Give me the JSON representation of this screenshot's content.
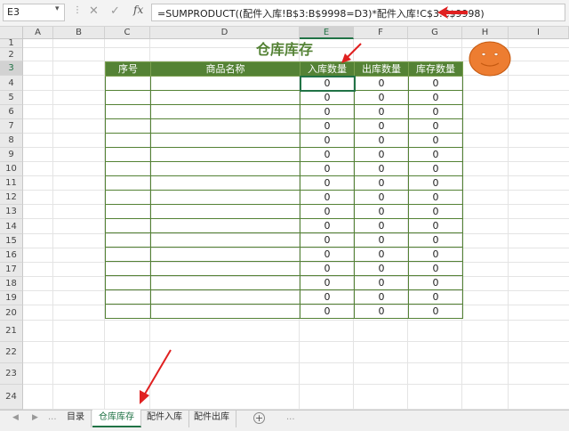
{
  "formula_bar": {
    "name_box": "E3",
    "formula": "=SUMPRODUCT((配件入库!B$3:B$9998=D3)*配件入库!C$3:C$9998)",
    "fx_label": "fx",
    "cancel_glyph": "✕",
    "enter_glyph": "✓"
  },
  "columns": [
    "A",
    "B",
    "C",
    "D",
    "E",
    "F",
    "G",
    "H",
    "I"
  ],
  "rows": [
    "1",
    "2",
    "3",
    "4",
    "5",
    "6",
    "7",
    "8",
    "9",
    "10",
    "11",
    "12",
    "13",
    "14",
    "15",
    "16",
    "17",
    "18",
    "19",
    "20",
    "21",
    "22",
    "23",
    "24"
  ],
  "sheet_title": "仓库库存",
  "table": {
    "headers": [
      "序号",
      "商品名称",
      "入库数量",
      "出库数量",
      "库存数量"
    ],
    "rows": [
      [
        "",
        "",
        "0",
        "0",
        "0"
      ],
      [
        "",
        "",
        "0",
        "0",
        "0"
      ],
      [
        "",
        "",
        "0",
        "0",
        "0"
      ],
      [
        "",
        "",
        "0",
        "0",
        "0"
      ],
      [
        "",
        "",
        "0",
        "0",
        "0"
      ],
      [
        "",
        "",
        "0",
        "0",
        "0"
      ],
      [
        "",
        "",
        "0",
        "0",
        "0"
      ],
      [
        "",
        "",
        "0",
        "0",
        "0"
      ],
      [
        "",
        "",
        "0",
        "0",
        "0"
      ],
      [
        "",
        "",
        "0",
        "0",
        "0"
      ],
      [
        "",
        "",
        "0",
        "0",
        "0"
      ],
      [
        "",
        "",
        "0",
        "0",
        "0"
      ],
      [
        "",
        "",
        "0",
        "0",
        "0"
      ],
      [
        "",
        "",
        "0",
        "0",
        "0"
      ],
      [
        "",
        "",
        "0",
        "0",
        "0"
      ],
      [
        "",
        "",
        "0",
        "0",
        "0"
      ],
      [
        "",
        "",
        "0",
        "0",
        "0"
      ]
    ]
  },
  "selected_cell": "E3",
  "sheet_tabs": [
    "目录",
    "仓库库存",
    "配件入库",
    "配件出库"
  ],
  "active_tab": "仓库库存",
  "nav": {
    "prev": "◀",
    "next": "▶",
    "dots": "...",
    "add": "+"
  },
  "colors": {
    "table_green": "#548235",
    "excel_green": "#217346",
    "arrow_red": "#e02020",
    "smiley_orange": "#ed7d31"
  }
}
